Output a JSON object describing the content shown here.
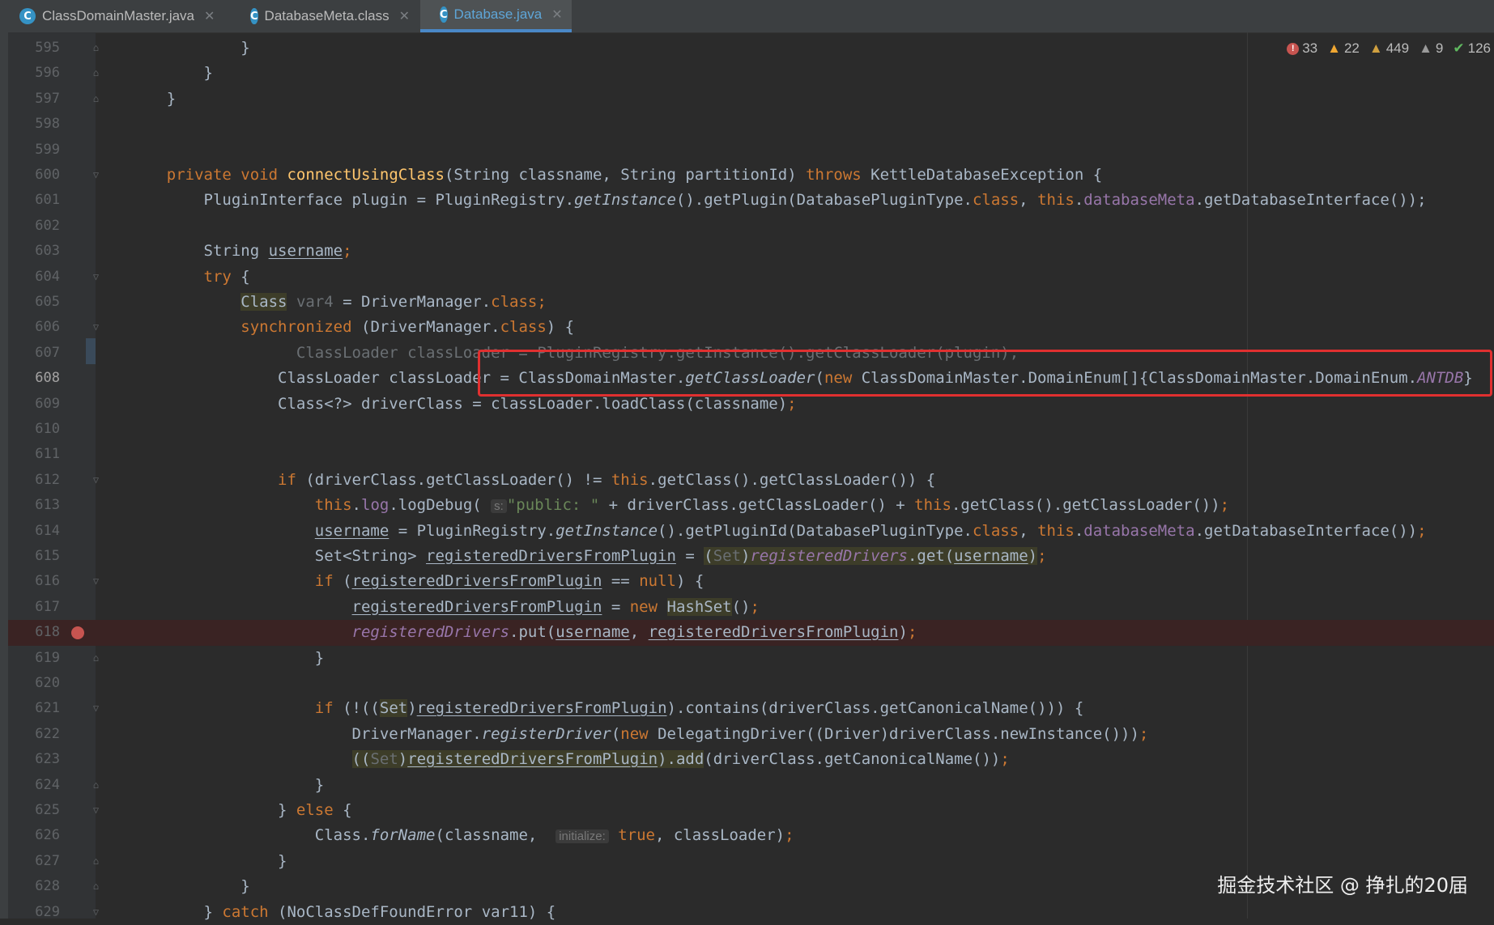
{
  "tabs": [
    {
      "label": "ClassDomainMaster.java",
      "icon": "C",
      "active": false
    },
    {
      "label": "DatabaseMeta.class",
      "icon": "C",
      "active": false
    },
    {
      "label": "Database.java",
      "icon": "C",
      "active": true
    }
  ],
  "inspections": {
    "errors": "33",
    "warnings": "22",
    "weak_warnings": "449",
    "typos": "9",
    "ok": "126"
  },
  "line_numbers": [
    "595",
    "596",
    "597",
    "598",
    "599",
    "600",
    "601",
    "602",
    "603",
    "604",
    "605",
    "606",
    "607",
    "608",
    "609",
    "610",
    "611",
    "612",
    "613",
    "614",
    "615",
    "616",
    "617",
    "618",
    "619",
    "620",
    "621",
    "622",
    "623",
    "624",
    "625",
    "626",
    "627",
    "628",
    "629"
  ],
  "breakpoint_line": "618",
  "hints": {
    "s": "s:",
    "initialize": "initialize:"
  },
  "watermark": "掘金技术社区 @ 挣扎的20届",
  "colors": {
    "background": "#2b2b2b",
    "keyword": "#cc7832",
    "method_decl": "#ffc66d",
    "field": "#9876aa",
    "string": "#6a8759",
    "highlight_box": "#e03030",
    "active_tab": "#4a88c7"
  }
}
